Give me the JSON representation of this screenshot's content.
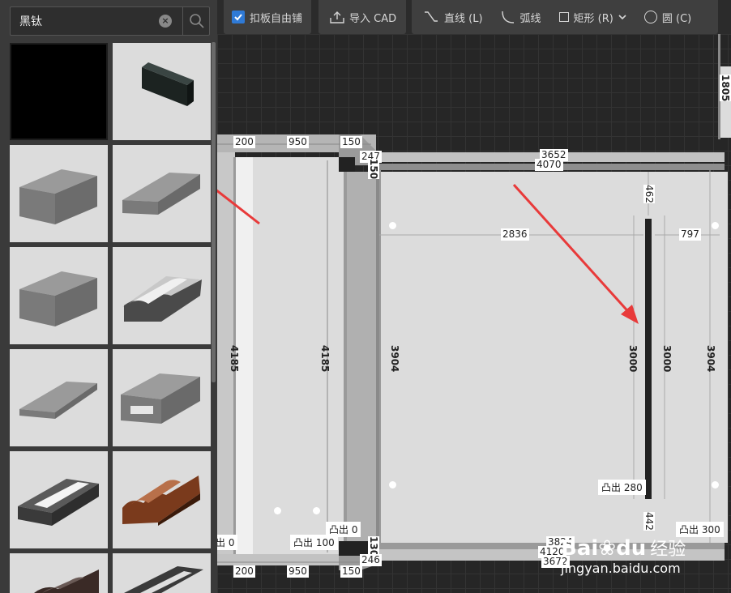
{
  "search": {
    "value": "黑钛"
  },
  "toolbar": {
    "free_tiling": "扣板自由铺",
    "import_cad": "导入 CAD",
    "line": "直线 (L)",
    "arc": "弧线",
    "rectangle": "矩形 (R)",
    "circle": "圆 (C)"
  },
  "tiles": [
    {
      "shape": "black-swatch"
    },
    {
      "shape": "dark-slab"
    },
    {
      "shape": "gray-block-tall"
    },
    {
      "shape": "gray-block-wedge"
    },
    {
      "shape": "gray-block-tall"
    },
    {
      "shape": "molding-wave"
    },
    {
      "shape": "gray-slab-thin"
    },
    {
      "shape": "channel-profile"
    },
    {
      "shape": "grooved-dark-strip"
    },
    {
      "shape": "wood-molding"
    },
    {
      "shape": "dark-molding"
    },
    {
      "shape": "dark-strip"
    }
  ],
  "dimensions": {
    "top_left_200": "200",
    "top_950": "950",
    "top_150": "150",
    "d247": "247",
    "d150": "150",
    "d3652": "3652",
    "d4070": "4070",
    "d1805": "1805",
    "d462": "462",
    "d2836": "2836",
    "d797": "797",
    "d4185a": "4185",
    "d4185b": "4185",
    "d3904a": "3904",
    "d3904b": "3904",
    "d3000a": "3000",
    "d3000b": "3000",
    "d442": "442",
    "d130": "130",
    "d246": "246",
    "d3824": "3824",
    "d4120": "4120",
    "d3672": "3672",
    "bottom_200": "200",
    "bottom_950": "950",
    "bottom_150": "150"
  },
  "labels": {
    "protrude_0_left": "出 0",
    "protrude_100": "凸出  100",
    "protrude_0_mid": "凸出  0",
    "protrude_280": "凸出  280",
    "protrude_300": "凸出  300"
  },
  "watermark": {
    "brand": "Bai",
    "brand2": "du",
    "brand_cn": "经验",
    "url": "jingyan.baidu.com"
  },
  "colors": {
    "accent": "#2f7ad6",
    "arrow": "#e83a3a"
  }
}
